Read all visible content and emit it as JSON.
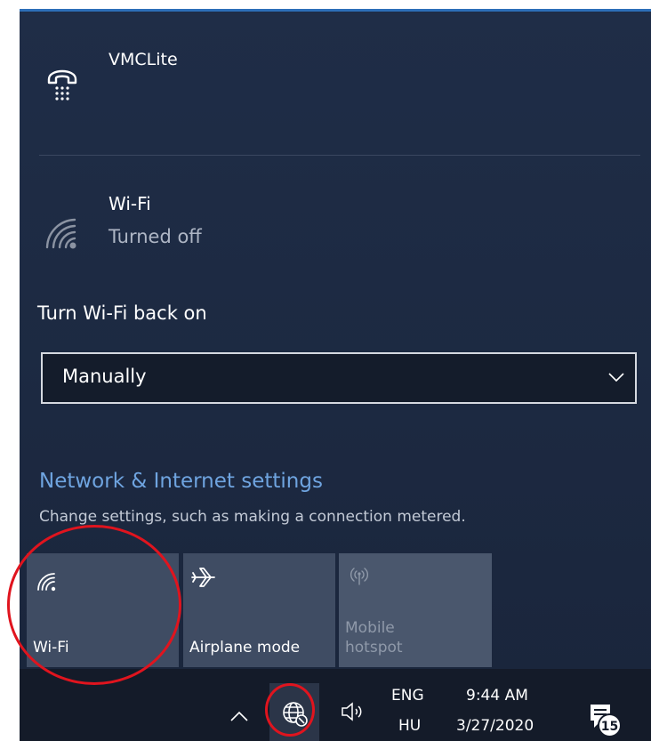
{
  "networks": {
    "vmc": {
      "name": "VMCLite",
      "icon": "dialup-phone-icon"
    },
    "wifi": {
      "name": "Wi-Fi",
      "status": "Turned off",
      "icon": "wifi-off-icon"
    }
  },
  "turn_on": {
    "label": "Turn Wi-Fi back on",
    "dropdown_value": "Manually"
  },
  "settings": {
    "link": "Network & Internet settings",
    "description": "Change settings, such as making a connection metered."
  },
  "quick_actions": [
    {
      "label": "Wi-Fi",
      "icon": "wifi-icon",
      "enabled": true
    },
    {
      "label": "Airplane mode",
      "icon": "airplane-icon",
      "enabled": true
    },
    {
      "label_line1": "Mobile",
      "label_line2": "hotspot",
      "icon": "mobile-hotspot-icon",
      "enabled": false
    }
  ],
  "taskbar": {
    "language_top": "ENG",
    "language_bottom": "HU",
    "time": "9:44 AM",
    "date": "3/27/2020",
    "notification_count": "15"
  },
  "colors": {
    "flyout_bg": "#1f2d47",
    "accent_link": "#6fa4e0",
    "tile_bg": "#3f4c63",
    "taskbar_bg": "#141b29",
    "highlight": "#e0141e"
  }
}
